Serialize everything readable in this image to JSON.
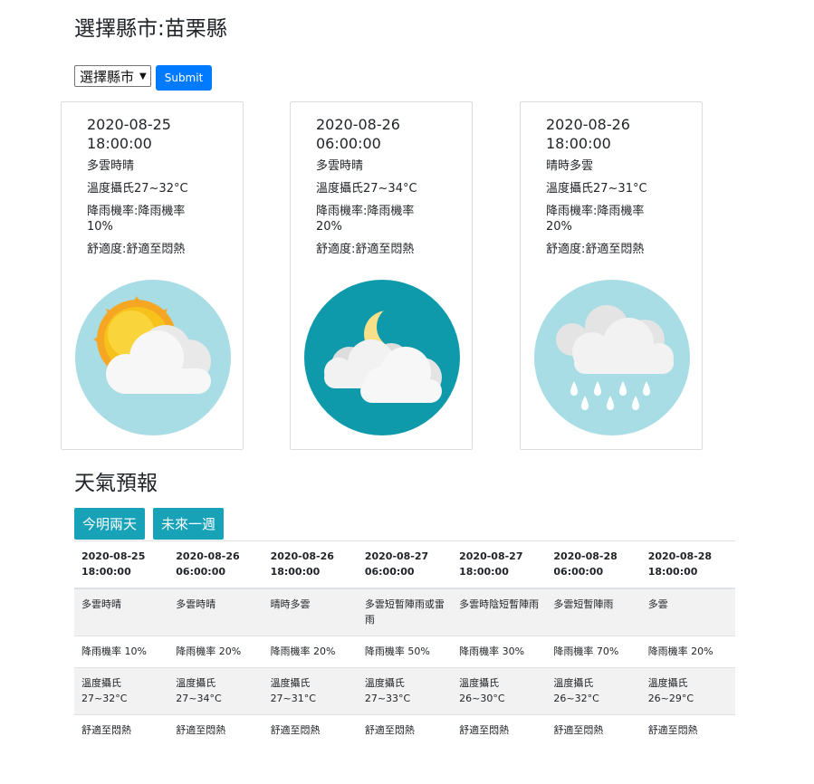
{
  "header": {
    "title": "選擇縣市:苗栗縣",
    "select_value": "選擇縣市",
    "submit_label": "Submit"
  },
  "cards": [
    {
      "date": "2020-08-25",
      "time": "18:00:00",
      "weather": "多雲時晴",
      "temp": "溫度攝氏27~32°C",
      "rain": "降雨機率:降雨機率",
      "rain_value": "10%",
      "comfort": "舒適度:舒適至悶熱",
      "icon": "sun-cloud-icon"
    },
    {
      "date": "2020-08-26",
      "time": "06:00:00",
      "weather": "多雲時晴",
      "temp": "溫度攝氏27~34°C",
      "rain": "降雨機率:降雨機率",
      "rain_value": "20%",
      "comfort": "舒適度:舒適至悶熱",
      "icon": "moon-cloud-icon"
    },
    {
      "date": "2020-08-26",
      "time": "18:00:00",
      "weather": "晴時多雲",
      "temp": "溫度攝氏27~31°C",
      "rain": "降雨機率:降雨機率",
      "rain_value": "20%",
      "comfort": "舒適度:舒適至悶熱",
      "icon": "rain-cloud-icon"
    }
  ],
  "forecast": {
    "title": "天氣預報",
    "tabs": [
      "今明兩天",
      "未來一週"
    ],
    "headers": [
      [
        "2020-08-25",
        "18:00:00"
      ],
      [
        "2020-08-26",
        "06:00:00"
      ],
      [
        "2020-08-26",
        "18:00:00"
      ],
      [
        "2020-08-27",
        "06:00:00"
      ],
      [
        "2020-08-27",
        "18:00:00"
      ],
      [
        "2020-08-28",
        "06:00:00"
      ],
      [
        "2020-08-28",
        "18:00:00"
      ]
    ],
    "rows": [
      [
        "多雲時晴",
        "多雲時晴",
        "晴時多雲",
        "多雲短暫陣雨或雷雨",
        "多雲時陰短暫陣雨",
        "多雲短暫陣雨",
        "多雲"
      ],
      [
        "降雨機率 10%",
        "降雨機率 20%",
        "降雨機率 20%",
        "降雨機率 50%",
        "降雨機率 30%",
        "降雨機率 70%",
        "降雨機率 20%"
      ],
      [
        [
          "溫度攝氏",
          "27~32°C"
        ],
        [
          "溫度攝氏",
          "27~34°C"
        ],
        [
          "溫度攝氏",
          "27~31°C"
        ],
        [
          "溫度攝氏",
          "27~33°C"
        ],
        [
          "溫度攝氏",
          "26~30°C"
        ],
        [
          "溫度攝氏",
          "26~32°C"
        ],
        [
          "溫度攝氏",
          "26~29°C"
        ]
      ],
      [
        "舒適至悶熱",
        "舒適至悶熱",
        "舒適至悶熱",
        "舒適至悶熱",
        "舒適至悶熱",
        "舒適至悶熱",
        "舒適至悶熱"
      ]
    ]
  },
  "colors": {
    "primary": "#007bff",
    "info": "#17a2b8",
    "sky_light": "#a9dde5",
    "sky_night": "#0f9aab"
  }
}
